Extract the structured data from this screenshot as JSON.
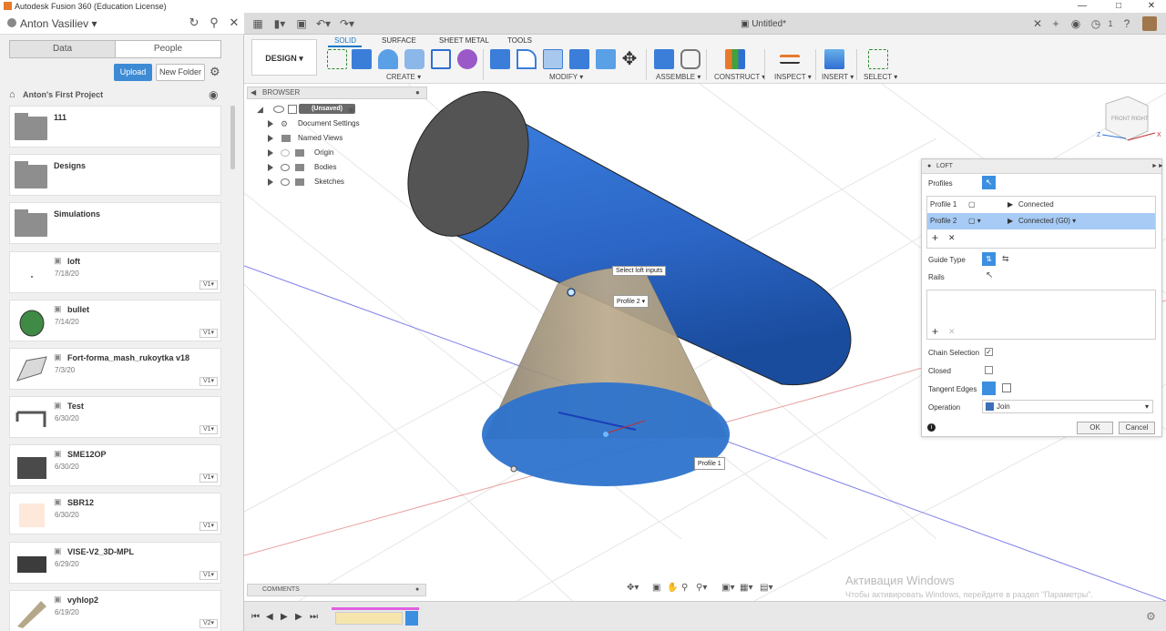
{
  "app": {
    "window_title": "Autodesk Fusion 360 (Education License)"
  },
  "data_panel": {
    "user": "Anton Vasiliev",
    "tabs": [
      "Data",
      "People"
    ],
    "upload": "Upload",
    "new_folder": "New Folder",
    "project": "Anton's First Project",
    "folders": [
      {
        "name": "111"
      },
      {
        "name": "Designs"
      },
      {
        "name": "Simulations"
      }
    ],
    "designs": [
      {
        "name": "loft",
        "date": "7/18/20",
        "version": "V1"
      },
      {
        "name": "bullet",
        "date": "7/14/20",
        "version": "V1"
      },
      {
        "name": "Fort-forma_mash_rukoytka v18",
        "date": "7/3/20",
        "version": "V1"
      },
      {
        "name": "Test",
        "date": "6/30/20",
        "version": "V1"
      },
      {
        "name": "SME12OP",
        "date": "6/30/20",
        "version": "V1"
      },
      {
        "name": "SBR12",
        "date": "6/30/20",
        "version": "V1"
      },
      {
        "name": "VISE-V2_3D-MPL",
        "date": "6/29/20",
        "version": "V1"
      },
      {
        "name": "vyhlop2",
        "date": "6/19/20",
        "version": "V2"
      }
    ]
  },
  "doc": {
    "tab_title": "Untitled*",
    "notification_count": "1"
  },
  "toolbar": {
    "workspace": "DESIGN",
    "tabs": [
      "SOLID",
      "SURFACE",
      "SHEET METAL",
      "TOOLS"
    ],
    "groups": [
      "CREATE",
      "MODIFY",
      "ASSEMBLE",
      "CONSTRUCT",
      "INSPECT",
      "INSERT",
      "SELECT"
    ]
  },
  "browser": {
    "title": "BROWSER",
    "root": "(Unsaved)",
    "nodes": [
      "Document Settings",
      "Named Views",
      "Origin",
      "Bodies",
      "Sketches"
    ]
  },
  "loft": {
    "title": "LOFT",
    "profiles_label": "Profiles",
    "profile_rows": [
      {
        "name": "Profile 1",
        "condition": "Connected"
      },
      {
        "name": "Profile 2",
        "condition": "Connected (G0)"
      }
    ],
    "guide_type": "Guide Type",
    "rails": "Rails",
    "chain_selection": "Chain Selection",
    "closed": "Closed",
    "tangent_edges": "Tangent Edges",
    "operation_label": "Operation",
    "operation_value": "Join",
    "ok": "OK",
    "cancel": "Cancel"
  },
  "viewport": {
    "tooltip": "Select loft inputs",
    "profile2_label": "Profile 2",
    "profile1_label": "Profile 1",
    "viewcube_front": "FRONT",
    "viewcube_right": "RIGHT",
    "axis_z": "Z",
    "axis_x": "X"
  },
  "comments": {
    "title": "COMMENTS"
  },
  "watermark": {
    "line1": "Активация Windows",
    "line2": "Чтобы активировать Windows, перейдите в раздел \"Параметры\"."
  },
  "colors": {
    "accent": "#1a77c6",
    "body_blue": "#2f6fd3",
    "loft_preview": "#b8a585",
    "selection": "#a7cbf5"
  }
}
